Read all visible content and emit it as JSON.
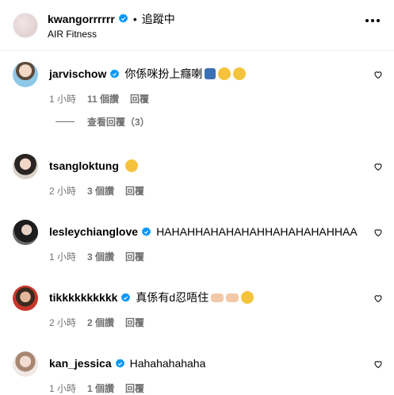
{
  "header": {
    "username": "kwangorrrrrr",
    "separator": "•",
    "follow_status": "追蹤中",
    "subtitle": "AIR Fitness"
  },
  "comments": [
    {
      "username": "jarvischow",
      "text": "你係咪扮上癮喇",
      "time": "1 小時",
      "likes": "11 個讚",
      "reply": "回覆"
    },
    {
      "username": "tsangloktung",
      "text": "",
      "time": "2 小時",
      "likes": "3 個讚",
      "reply": "回覆"
    },
    {
      "username": "lesleychianglove",
      "text": "HAHAHHAHAHAHAHHAHAHAHAHHAA",
      "time": "1 小時",
      "likes": "3 個讚",
      "reply": "回覆"
    },
    {
      "username": "tikkkkkkkkkk",
      "text": "真係有d忍唔住",
      "time": "2 小時",
      "likes": "2 個讚",
      "reply": "回覆"
    },
    {
      "username": "kan_jessica",
      "text": "Hahahahahaha",
      "time": "1 小時",
      "likes": "1 個讚",
      "reply": "回覆"
    }
  ],
  "view_replies": "查看回覆（3）",
  "colors": {
    "verified": "#0095f6",
    "meta": "#737373"
  }
}
